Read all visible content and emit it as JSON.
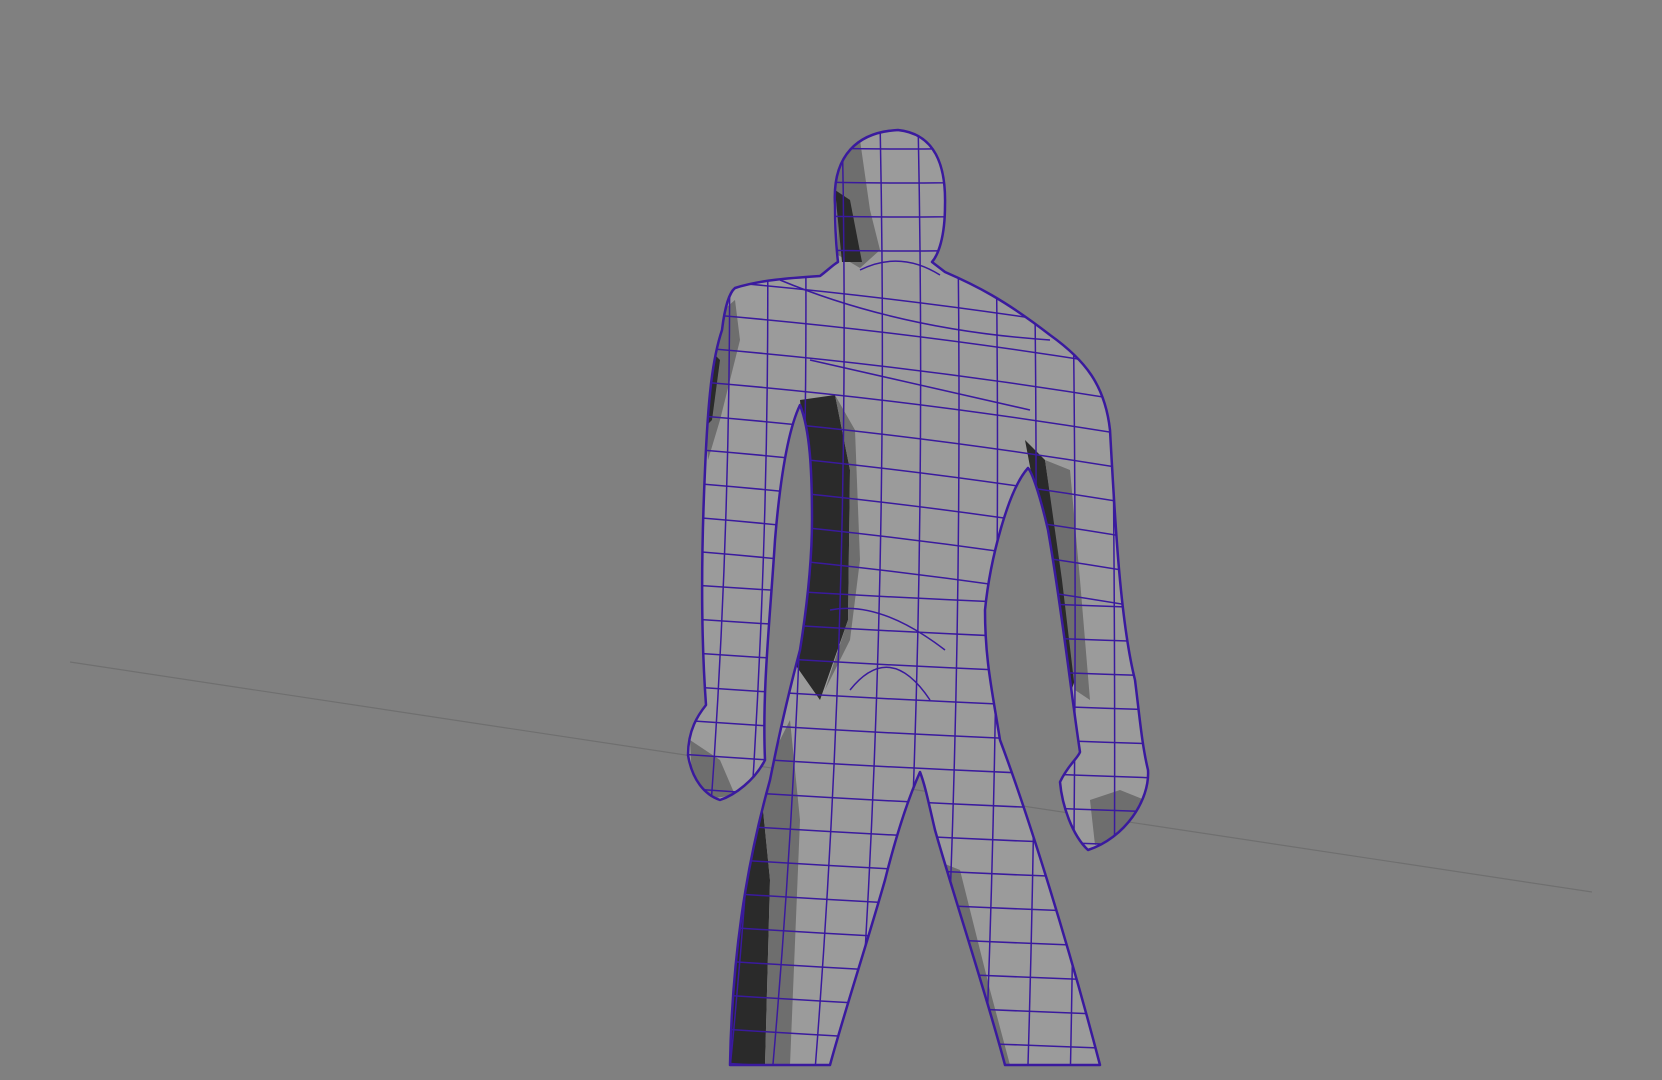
{
  "viewport": {
    "mode": "shaded-wireframe",
    "object": "humanoid-base-mesh",
    "view": "back, low angle",
    "colors": {
      "background": "#808080",
      "mesh_light": "#9b9b9b",
      "mesh_mid": "#6e6e6e",
      "mesh_dark": "#2a2a2a",
      "wireframe": "#3a1a9e",
      "ground_grid": "#6f6f6f"
    }
  }
}
